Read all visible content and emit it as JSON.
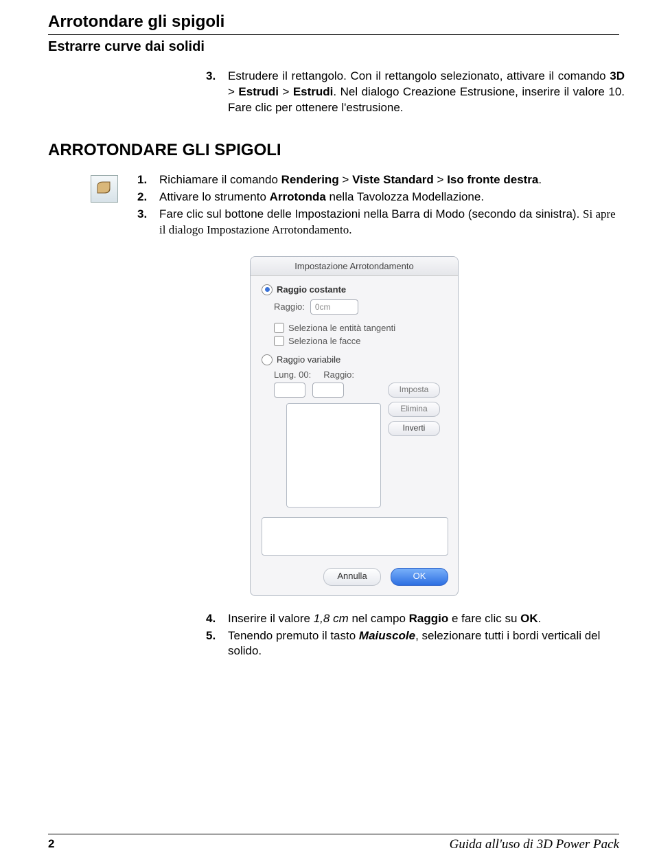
{
  "header": {
    "title": "Arrotondare gli spigoli",
    "subtitle": "Estrarre curve dai solidi"
  },
  "intro": {
    "num": "3.",
    "text_a": "Estrudere il rettangolo. Con il rettangolo selezionato, attivare il comando ",
    "cmd1": "3D",
    "sep1": " > ",
    "cmd2": "Estrudi",
    "sep2": " > ",
    "cmd3": "Estrudi",
    "text_b": ". Nel dialogo Creazione Estrusione, inserire il valore 10. Fare clic per ottenere l'estrusione."
  },
  "section": {
    "title": "ARROTONDARE GLI SPIGOLI"
  },
  "steps1": [
    {
      "num": "1.",
      "pre": "Richiamare il comando ",
      "b1": "Rendering",
      "sep1": " > ",
      "b2": "Viste Standard",
      "sep2": " > ",
      "b3": "Iso fronte destra",
      "post": "."
    },
    {
      "num": "2.",
      "pre": "Attivare lo strumento ",
      "b1": "Arrotonda",
      "post": " nella Tavolozza Modellazione."
    },
    {
      "num": "3.",
      "pre": "Fare clic sul bottone delle Impostazioni nella Barra di Modo (secondo da sinistra). ",
      "serif": "Si apre il dialogo Impostazione Arrotondamento."
    }
  ],
  "dialog": {
    "title": "Impostazione Arrotondamento",
    "radio_const": "Raggio costante",
    "label_raggio": "Raggio:",
    "value_raggio": "0cm",
    "check1": "Seleziona le entità tangenti",
    "check2": "Seleziona le facce",
    "radio_var": "Raggio variabile",
    "label_lung": "Lung. 00:",
    "label_raggio2": "Raggio:",
    "btn_imposta": "Imposta",
    "btn_elimina": "Elimina",
    "btn_inverti": "Inverti",
    "btn_cancel": "Annulla",
    "btn_ok": "OK"
  },
  "steps2": [
    {
      "num": "4.",
      "pre": "Inserire il valore ",
      "i": "1,8 cm",
      "mid": " nel campo ",
      "b": "Raggio",
      "mid2": " e fare clic su ",
      "b2": "OK",
      "post": "."
    },
    {
      "num": "5.",
      "pre": "Tenendo premuto il tasto ",
      "bi": "Maiuscole",
      "post": ", selezionare tutti i bordi verticali del solido."
    }
  ],
  "footer": {
    "page": "2",
    "guide": "Guida all'uso di 3D Power Pack"
  }
}
